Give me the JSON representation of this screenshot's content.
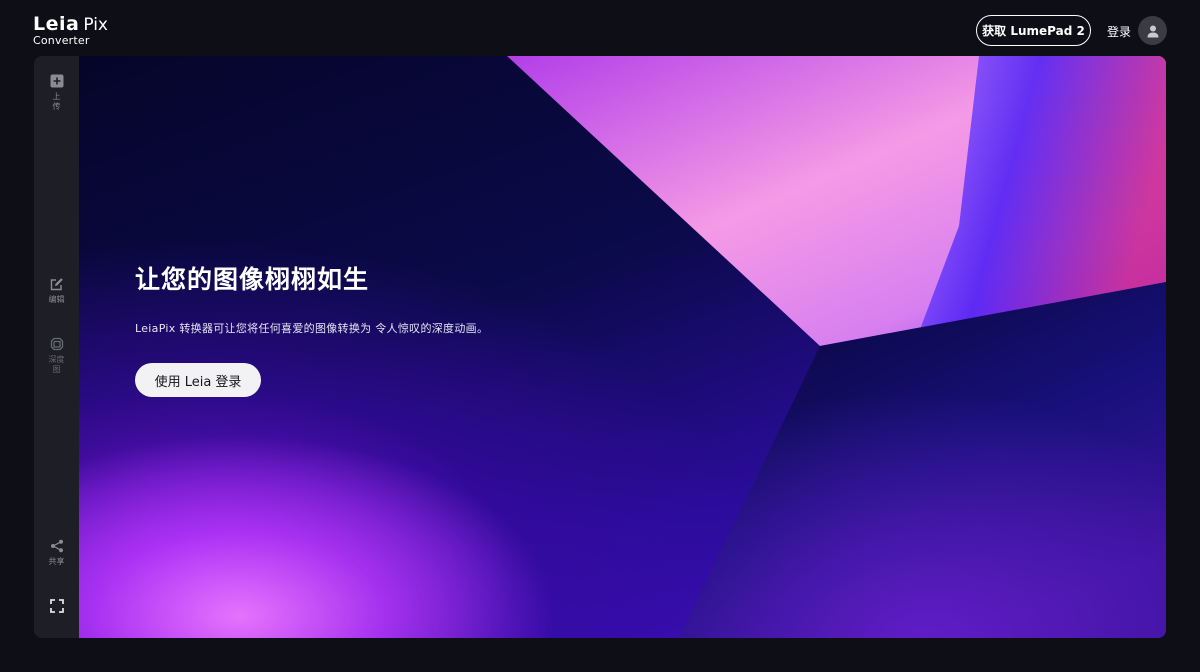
{
  "header": {
    "logo_leia": "Leia",
    "logo_pix": "Pix",
    "logo_sub": "Converter",
    "get_lumepad_label": "获取 LumePad 2",
    "login_label": "登录"
  },
  "sidebar": {
    "items": [
      {
        "label": "上传",
        "icon": "upload-plus-icon"
      },
      {
        "label": "编辑",
        "icon": "edit-icon"
      },
      {
        "label": "深度图",
        "icon": "depth-map-icon"
      },
      {
        "label": "共享",
        "icon": "share-icon"
      },
      {
        "label": "",
        "icon": "fullscreen-icon"
      }
    ]
  },
  "hero": {
    "title": "让您的图像栩栩如生",
    "description": "LeiaPix 转换器可让您将任何喜爱的图像转换为 令人惊叹的深度动画。",
    "cta_label": "使用 Leia 登录"
  },
  "colors": {
    "background": "#0d0e16",
    "sidebar": "#1d1e26",
    "accent_purple": "#7a1cf0",
    "accent_pink": "#f08be8"
  }
}
